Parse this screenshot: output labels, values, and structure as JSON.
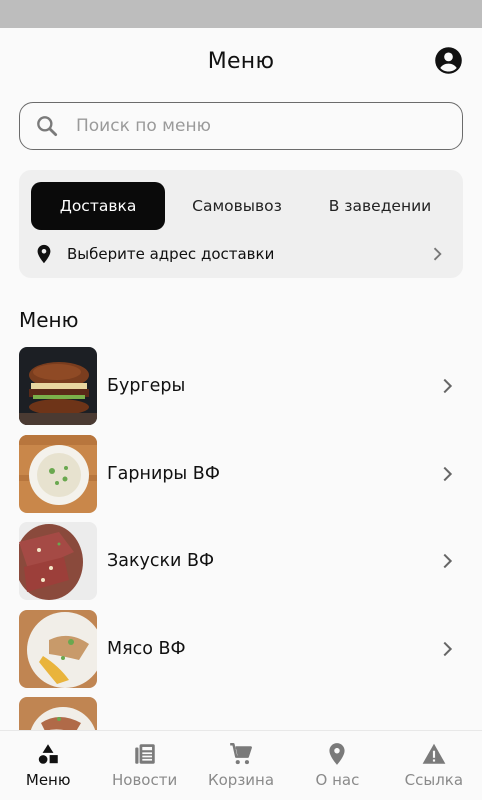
{
  "header": {
    "title": "Меню"
  },
  "search": {
    "placeholder": "Поиск по меню"
  },
  "order": {
    "tabs": [
      {
        "label": "Доставка",
        "active": true
      },
      {
        "label": "Самовывоз",
        "active": false
      },
      {
        "label": "В заведении",
        "active": false
      }
    ],
    "address_prompt": "Выберите адрес доставки"
  },
  "menu": {
    "section_title": "Меню",
    "items": [
      {
        "label": "Бургеры"
      },
      {
        "label": "Гарниры ВФ"
      },
      {
        "label": "Закуски ВФ"
      },
      {
        "label": "Мясо ВФ"
      },
      {
        "label": ""
      }
    ]
  },
  "nav": {
    "items": [
      {
        "label": "Меню",
        "icon": "shapes-icon",
        "active": true
      },
      {
        "label": "Новости",
        "icon": "newspaper-icon",
        "active": false
      },
      {
        "label": "Корзина",
        "icon": "cart-icon",
        "active": false
      },
      {
        "label": "О нас",
        "icon": "location-pin-icon",
        "active": false
      },
      {
        "label": "Ссылка",
        "icon": "warning-icon",
        "active": false
      }
    ]
  },
  "colors": {
    "accent": "#0a0a0a",
    "nav_inactive": "#8a8a8a",
    "card_bg": "#efefef",
    "status_bar": "#bdbdbd"
  }
}
